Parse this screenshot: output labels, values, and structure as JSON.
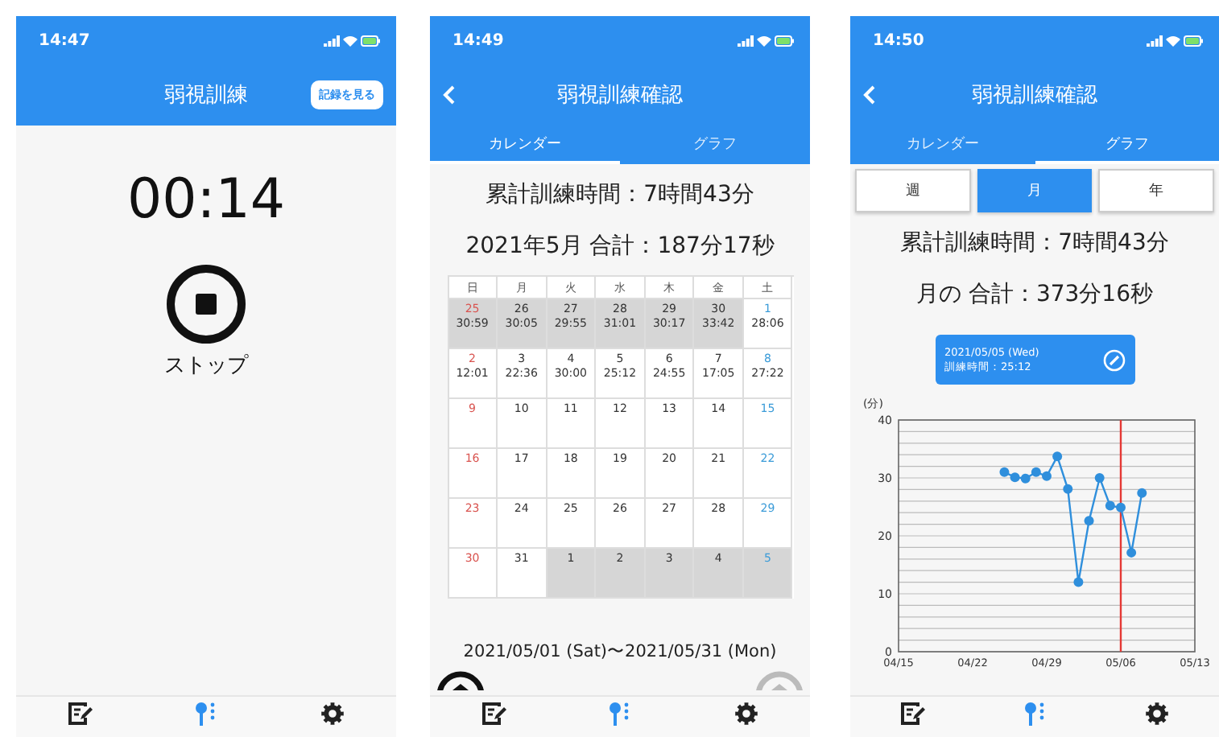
{
  "timer_screen": {
    "status_bar": {
      "time": "14:47"
    },
    "header": {
      "title": "弱視訓練",
      "button": "記録を見る"
    },
    "timer": "00:14",
    "stop_label": "ストップ",
    "tab_bar": [
      {
        "selected": false
      },
      {
        "selected": true
      },
      {
        "selected": false
      }
    ]
  },
  "calendar_screen": {
    "status_bar": {
      "time": "14:49"
    },
    "header": {
      "title": "弱視訓練確認"
    },
    "tabs": [
      {
        "label": "カレンダー",
        "selected": true
      },
      {
        "label": "グラフ",
        "selected": false
      }
    ],
    "total_time": "累計訓練時間：7時間43分",
    "month_total": "2021年5月 合計：187分17秒",
    "weekdays": [
      "日",
      "月",
      "火",
      "水",
      "木",
      "金",
      "土"
    ],
    "weeks": [
      [
        {
          "day": "25",
          "time": "30:59",
          "outside_month": true
        },
        {
          "day": "26",
          "time": "30:05",
          "outside_month": true
        },
        {
          "day": "27",
          "time": "29:55",
          "outside_month": true
        },
        {
          "day": "28",
          "time": "31:01",
          "outside_month": true
        },
        {
          "day": "29",
          "time": "30:17",
          "outside_month": true
        },
        {
          "day": "30",
          "time": "33:42",
          "outside_month": true
        },
        {
          "day": "1",
          "time": "28:06",
          "outside_month": false
        }
      ],
      [
        {
          "day": "2",
          "time": "12:01",
          "outside_month": false
        },
        {
          "day": "3",
          "time": "22:36",
          "outside_month": false
        },
        {
          "day": "4",
          "time": "30:00",
          "outside_month": false
        },
        {
          "day": "5",
          "time": "25:12",
          "outside_month": false
        },
        {
          "day": "6",
          "time": "24:55",
          "outside_month": false
        },
        {
          "day": "7",
          "time": "17:05",
          "outside_month": false
        },
        {
          "day": "8",
          "time": "27:22",
          "outside_month": false
        }
      ],
      [
        {
          "day": "9",
          "outside_month": false
        },
        {
          "day": "10",
          "outside_month": false
        },
        {
          "day": "11",
          "outside_month": false
        },
        {
          "day": "12",
          "outside_month": false
        },
        {
          "day": "13",
          "outside_month": false
        },
        {
          "day": "14",
          "outside_month": false
        },
        {
          "day": "15",
          "outside_month": false
        }
      ],
      [
        {
          "day": "16",
          "outside_month": false
        },
        {
          "day": "17",
          "outside_month": false
        },
        {
          "day": "18",
          "outside_month": false
        },
        {
          "day": "19",
          "outside_month": false
        },
        {
          "day": "20",
          "outside_month": false
        },
        {
          "day": "21",
          "outside_month": false
        },
        {
          "day": "22",
          "outside_month": false
        }
      ],
      [
        {
          "day": "23",
          "outside_month": false
        },
        {
          "day": "24",
          "outside_month": false
        },
        {
          "day": "25",
          "outside_month": false
        },
        {
          "day": "26",
          "outside_month": false
        },
        {
          "day": "27",
          "outside_month": false
        },
        {
          "day": "28",
          "outside_month": false
        },
        {
          "day": "29",
          "outside_month": false
        }
      ],
      [
        {
          "day": "30",
          "outside_month": false
        },
        {
          "day": "31",
          "outside_month": false
        },
        {
          "day": "1",
          "outside_month": true
        },
        {
          "day": "2",
          "outside_month": true
        },
        {
          "day": "3",
          "outside_month": true
        },
        {
          "day": "4",
          "outside_month": true
        },
        {
          "day": "5",
          "outside_month": true
        }
      ]
    ],
    "range": "2021/05/01 (Sat)〜2021/05/31 (Mon)",
    "month_nav": [
      {
        "disabled": false
      },
      {
        "disabled": true
      }
    ],
    "tab_bar": [
      {
        "selected": false
      },
      {
        "selected": true
      },
      {
        "selected": false
      }
    ]
  },
  "graph_screen": {
    "status_bar": {
      "time": "14:50"
    },
    "header": {
      "title": "弱視訓練確認"
    },
    "tabs": [
      {
        "label": "カレンダー",
        "selected": false
      },
      {
        "label": "グラフ",
        "selected": true
      }
    ],
    "periods": [
      {
        "label": "週",
        "selected": false
      },
      {
        "label": "月",
        "selected": true
      },
      {
        "label": "年",
        "selected": false
      }
    ],
    "total_time": "累計訓練時間：7時間43分",
    "month_total": "月の 合計：373分16秒",
    "tooltip": {
      "date": "2021/05/05 (Wed)",
      "detail": "訓練時間：25:12"
    },
    "chart_data": {
      "type": "line",
      "ylabel": "(分)",
      "categories": [
        "04/15",
        null,
        null,
        null,
        null,
        null,
        null,
        "04/22",
        null,
        null,
        null,
        null,
        null,
        null,
        "04/29",
        null,
        null,
        null,
        null,
        null,
        null,
        "05/06",
        null,
        null,
        null,
        null,
        null,
        null,
        "05/13"
      ],
      "grid": true,
      "series": [
        {
          "color": "#2f8fdc",
          "marker": true,
          "values": [
            null,
            null,
            null,
            null,
            null,
            null,
            null,
            null,
            null,
            null,
            31,
            30.1,
            29.9,
            31,
            30.3,
            33.7,
            28.1,
            12,
            22.6,
            30,
            25.2,
            24.9,
            17.1,
            27.4,
            null,
            null,
            null,
            null,
            null
          ]
        }
      ],
      "ylim": [
        0,
        40
      ],
      "yticks": [
        0,
        10,
        20,
        30,
        40
      ],
      "annotations": [
        {
          "x": "05/06"
        }
      ]
    },
    "tab_bar": [
      {
        "selected": false
      },
      {
        "selected": true
      },
      {
        "selected": false
      }
    ]
  }
}
